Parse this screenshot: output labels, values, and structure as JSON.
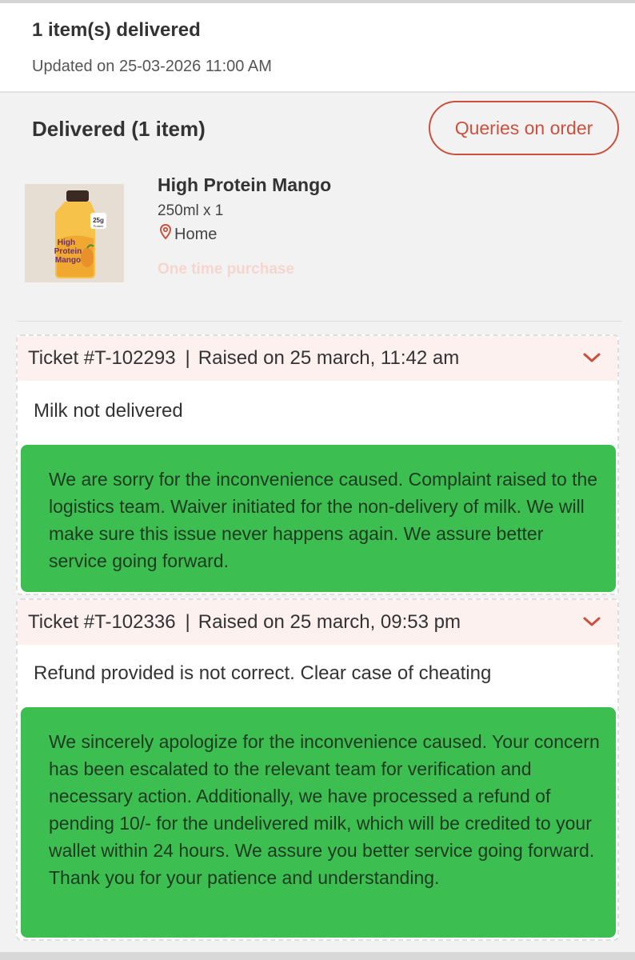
{
  "status": {
    "title": "1 item(s) delivered",
    "updated": "Updated on 25-03-2026 11:00 AM"
  },
  "delivery": {
    "title": "Delivered (1 item)",
    "queries_button": "Queries on order"
  },
  "product": {
    "name": "High Protein Mango",
    "quantity": "250ml x 1",
    "location": "Home",
    "purchase_type": "One time purchase",
    "image_labels": {
      "protein_amount": "25g",
      "protein_word": "Protein",
      "brand_line1": "High",
      "brand_line2": "Protein",
      "brand_line3": "Mango"
    }
  },
  "tickets": [
    {
      "id": "Ticket #T-102293",
      "separator": "|",
      "raised": "Raised on  25 march, 11:42 am",
      "issue": "Milk not delivered",
      "reply": "We are sorry for the inconvenience caused. Complaint raised to the logistics team. Waiver initiated for the non-delivery of milk. We will make sure this issue never happens again. We assure better service going forward."
    },
    {
      "id": "Ticket #T-102336",
      "separator": "|",
      "raised": "Raised on  25 march, 09:53 pm",
      "issue": "Refund provided is not correct. Clear case of cheating",
      "reply": "We sincerely apologize for the inconvenience caused. Your concern has been escalated to the relevant team for verification and necessary action. Additionally, we have processed a refund of pending 10/- for the undelivered milk, which will be credited to your wallet within 24 hours. We assure you better service going forward. Thank you for your patience and understanding."
    }
  ],
  "colors": {
    "accent": "#c9513e",
    "reply_bg": "#3cbf50",
    "ticket_head_bg": "#fdf1f0",
    "purchase_text": "#f5d6cf"
  },
  "icons": {
    "location": "map-pin-icon",
    "expand": "chevron-down-icon"
  }
}
